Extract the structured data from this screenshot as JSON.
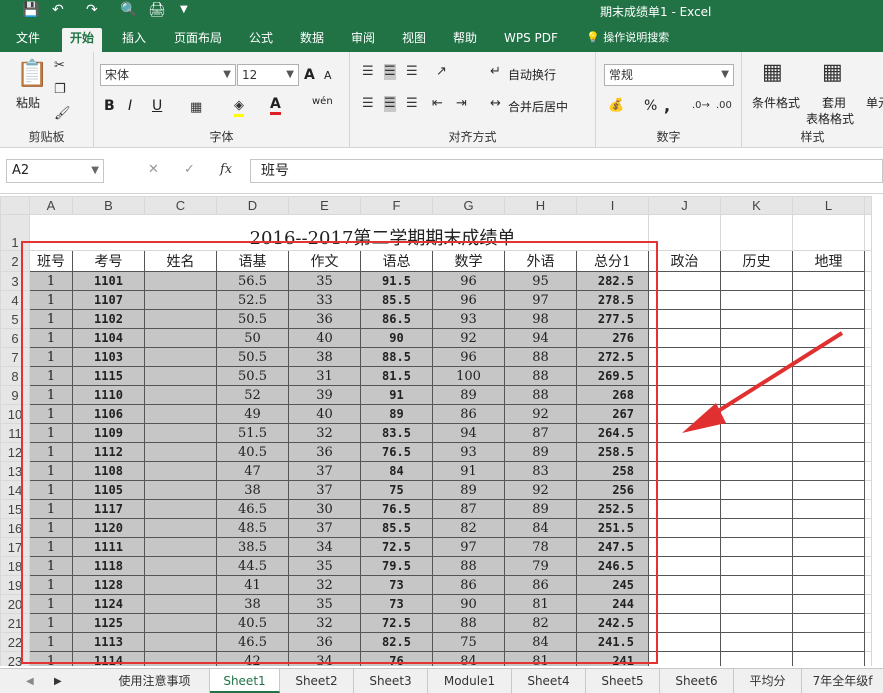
{
  "titlebar": {
    "title": "期末成绩单1 - Excel"
  },
  "qat": {
    "save_icon": "save-icon",
    "undo_icon": "undo-icon",
    "redo_icon": "redo-icon",
    "preview_icon": "print-preview-icon",
    "print_icon": "print-icon",
    "more_icon": "chevron-down-icon"
  },
  "tabs": [
    "文件",
    "开始",
    "插入",
    "页面布局",
    "公式",
    "数据",
    "审阅",
    "视图",
    "帮助",
    "WPS PDF",
    "操作说明搜索"
  ],
  "ribbon": {
    "clipboard": {
      "label": "剪贴板",
      "paste": "粘贴"
    },
    "font": {
      "label": "字体",
      "name": "宋体",
      "size": "12",
      "bold": "B",
      "italic": "I",
      "underline": "U",
      "grow": "A",
      "shrink": "A",
      "fontcolor": "A",
      "wen": "wén"
    },
    "align": {
      "label": "对齐方式",
      "wrap": "自动换行",
      "merge": "合并后居中"
    },
    "number": {
      "label": "数字",
      "format": "常规",
      "percent": "%",
      "comma": ","
    },
    "styles": {
      "label": "样式",
      "cond": "条件格式",
      "table1": "套用",
      "table2": "表格格式",
      "cell": "单元"
    }
  },
  "formula_bar": {
    "cell_ref": "A2",
    "value": "班号",
    "fx": "fx"
  },
  "sheet": {
    "columns": [
      "A",
      "B",
      "C",
      "D",
      "E",
      "F",
      "G",
      "H",
      "I",
      "J",
      "K",
      "L"
    ],
    "title": "2016--2017第二学期期末成绩单",
    "headers": [
      "班号",
      "考号",
      "姓名",
      "语基",
      "作文",
      "语总",
      "数学",
      "外语",
      "总分1",
      "政治",
      "历史",
      "地理"
    ],
    "rows": [
      [
        "1",
        "1101",
        "",
        "56.5",
        "35",
        "91.5",
        "96",
        "95",
        "282.5"
      ],
      [
        "1",
        "1107",
        "",
        "52.5",
        "33",
        "85.5",
        "96",
        "97",
        "278.5"
      ],
      [
        "1",
        "1102",
        "",
        "50.5",
        "36",
        "86.5",
        "93",
        "98",
        "277.5"
      ],
      [
        "1",
        "1104",
        "",
        "50",
        "40",
        "90",
        "92",
        "94",
        "276"
      ],
      [
        "1",
        "1103",
        "",
        "50.5",
        "38",
        "88.5",
        "96",
        "88",
        "272.5"
      ],
      [
        "1",
        "1115",
        "",
        "50.5",
        "31",
        "81.5",
        "100",
        "88",
        "269.5"
      ],
      [
        "1",
        "1110",
        "",
        "52",
        "39",
        "91",
        "89",
        "88",
        "268"
      ],
      [
        "1",
        "1106",
        "",
        "49",
        "40",
        "89",
        "86",
        "92",
        "267"
      ],
      [
        "1",
        "1109",
        "",
        "51.5",
        "32",
        "83.5",
        "94",
        "87",
        "264.5"
      ],
      [
        "1",
        "1112",
        "",
        "40.5",
        "36",
        "76.5",
        "93",
        "89",
        "258.5"
      ],
      [
        "1",
        "1108",
        "",
        "47",
        "37",
        "84",
        "91",
        "83",
        "258"
      ],
      [
        "1",
        "1105",
        "",
        "38",
        "37",
        "75",
        "89",
        "92",
        "256"
      ],
      [
        "1",
        "1117",
        "",
        "46.5",
        "30",
        "76.5",
        "87",
        "89",
        "252.5"
      ],
      [
        "1",
        "1120",
        "",
        "48.5",
        "37",
        "85.5",
        "82",
        "84",
        "251.5"
      ],
      [
        "1",
        "1111",
        "",
        "38.5",
        "34",
        "72.5",
        "97",
        "78",
        "247.5"
      ],
      [
        "1",
        "1118",
        "",
        "44.5",
        "35",
        "79.5",
        "88",
        "79",
        "246.5"
      ],
      [
        "1",
        "1128",
        "",
        "41",
        "32",
        "73",
        "86",
        "86",
        "245"
      ],
      [
        "1",
        "1124",
        "",
        "38",
        "35",
        "73",
        "90",
        "81",
        "244"
      ],
      [
        "1",
        "1125",
        "",
        "40.5",
        "32",
        "72.5",
        "88",
        "82",
        "242.5"
      ],
      [
        "1",
        "1113",
        "",
        "46.5",
        "36",
        "82.5",
        "75",
        "84",
        "241.5"
      ],
      [
        "1",
        "1114",
        "",
        "42",
        "34",
        "76",
        "84",
        "81",
        "241"
      ]
    ]
  },
  "sheet_tabs": [
    "使用注意事项",
    "Sheet1",
    "Sheet2",
    "Sheet3",
    "Module1",
    "Sheet4",
    "Sheet5",
    "Sheet6",
    "平均分",
    "7年全年级f"
  ]
}
